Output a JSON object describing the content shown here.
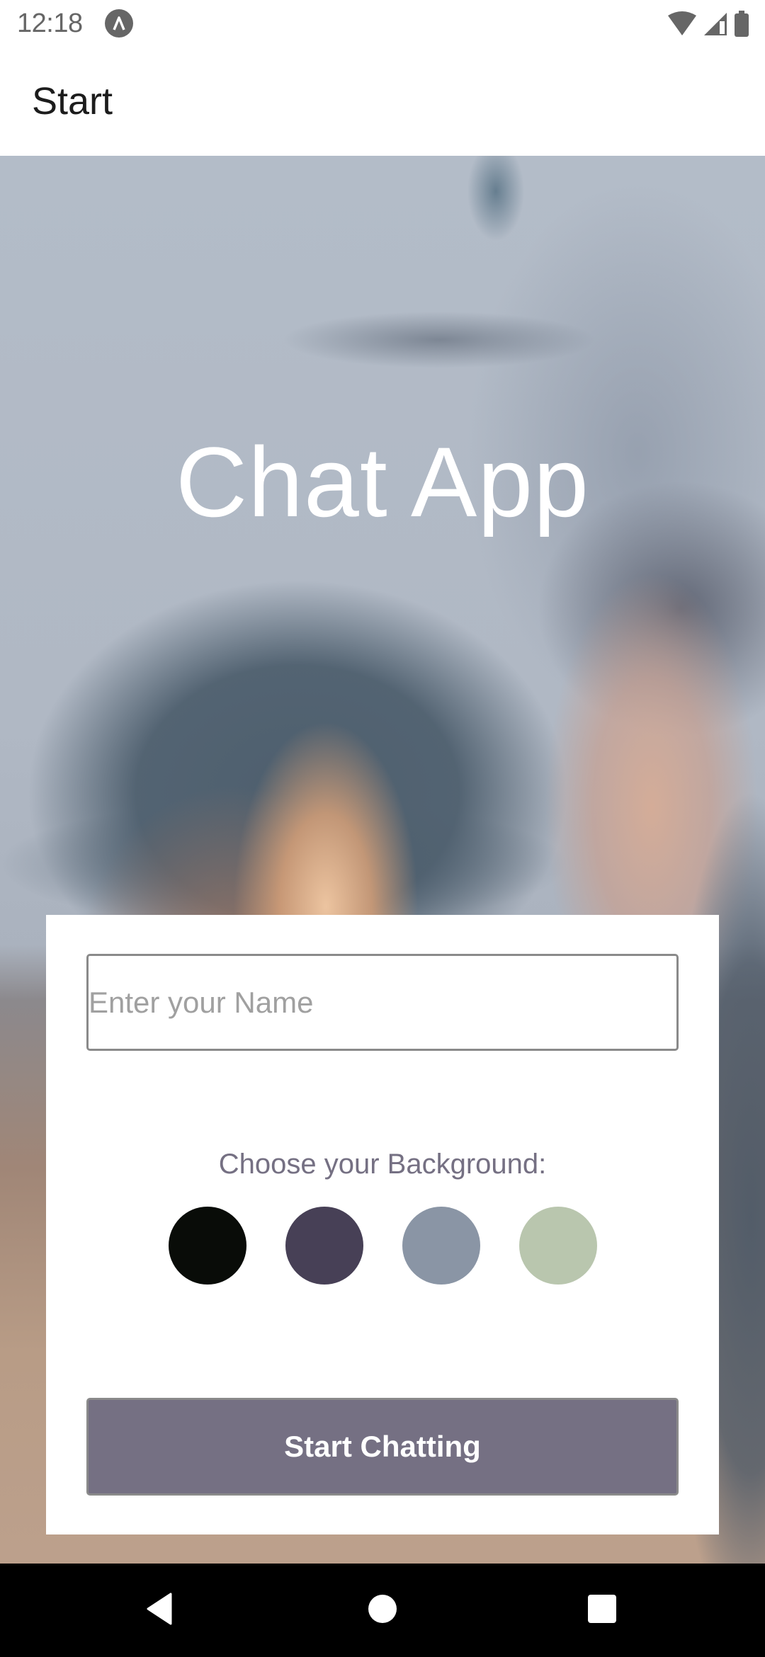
{
  "status_bar": {
    "time": "12:18",
    "app_icon": "expo-caret-icon",
    "icons": [
      "wifi-icon",
      "cellular-signal-icon",
      "battery-icon"
    ]
  },
  "header": {
    "title": "Start"
  },
  "hero": {
    "title": "Chat App",
    "background": "blurred photo of two laughing women"
  },
  "form": {
    "name_input": {
      "value": "",
      "placeholder": "Enter your Name"
    },
    "background_label": "Choose your Background:",
    "background_colors": [
      {
        "name": "black",
        "hex": "#090C08"
      },
      {
        "name": "purple",
        "hex": "#474056"
      },
      {
        "name": "blue-gray",
        "hex": "#8A95A5"
      },
      {
        "name": "green",
        "hex": "#B9C6AE"
      }
    ],
    "start_button_label": "Start Chatting",
    "button_color": "#757083"
  },
  "nav_bar": {
    "buttons": [
      "back-icon",
      "home-icon",
      "recents-icon"
    ]
  }
}
